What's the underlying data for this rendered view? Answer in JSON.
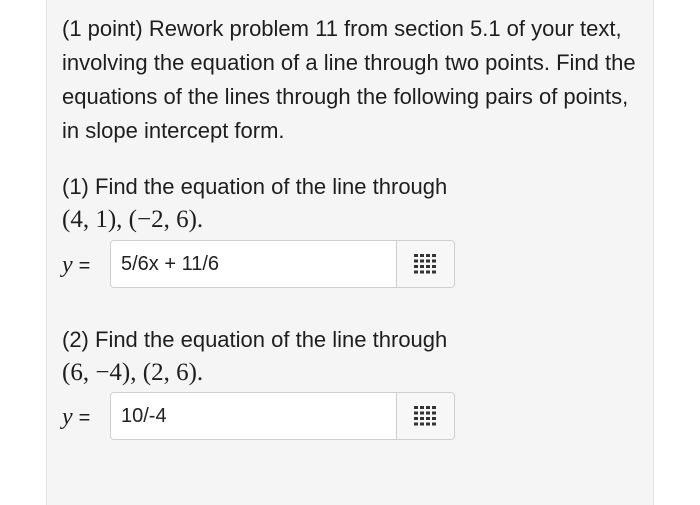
{
  "problem": {
    "intro": "(1 point) Rework problem 11 from section 5.1 of your text, involving the equation of a line through two points. Find the equations of the lines through the following pairs of points, in slope intercept form."
  },
  "questions": [
    {
      "prompt": "(1) Find the equation of the line through",
      "points": "(4, 1), (−2, 6).",
      "answer_var": "y",
      "answer_eq": "=",
      "answer_value": "5/6x + 11/6",
      "palette_icon": "equation-editor-grid-icon"
    },
    {
      "prompt": "(2) Find the equation of the line through",
      "points": "(6, −4), (2, 6).",
      "answer_var": "y",
      "answer_eq": "=",
      "answer_value": "10/-4",
      "palette_icon": "equation-editor-grid-icon"
    }
  ]
}
